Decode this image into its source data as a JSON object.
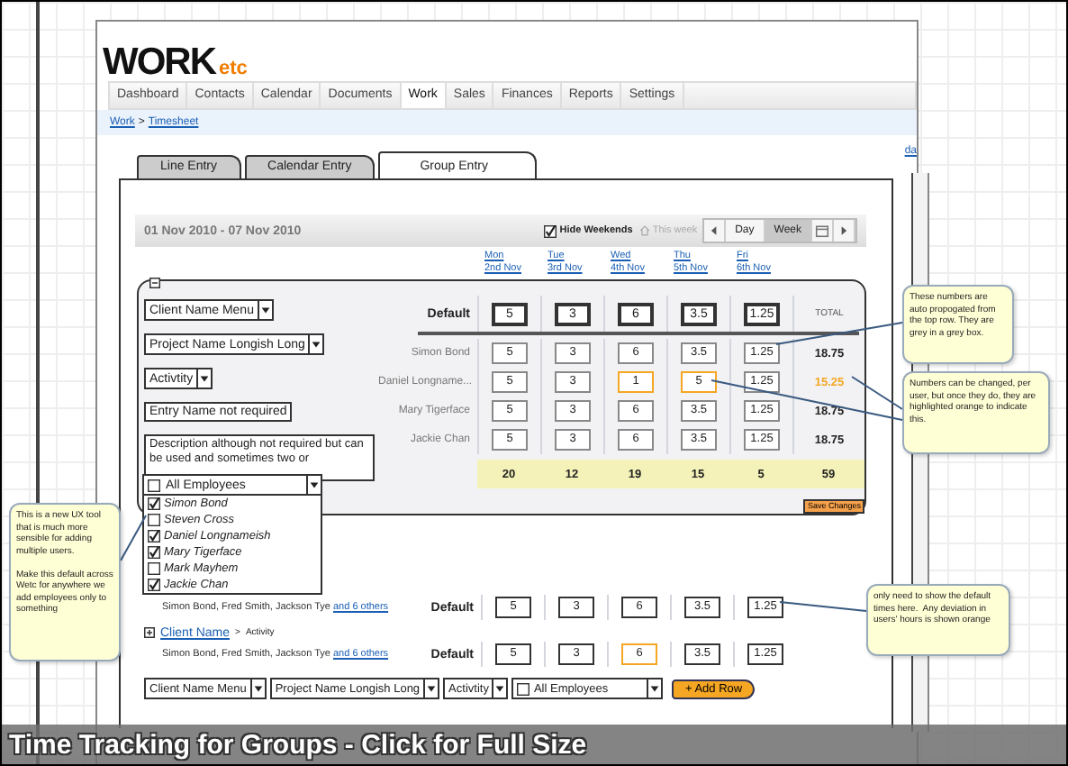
{
  "logo": {
    "text": "WORK",
    "suffix": "etc"
  },
  "nav": [
    {
      "label": "Dashboard",
      "selected": false
    },
    {
      "label": "Contacts",
      "selected": false
    },
    {
      "label": "Calendar",
      "selected": false
    },
    {
      "label": "Documents",
      "selected": false
    },
    {
      "label": "Work",
      "selected": true
    },
    {
      "label": "Sales",
      "selected": false
    },
    {
      "label": "Finances",
      "selected": false
    },
    {
      "label": "Reports",
      "selected": false
    },
    {
      "label": "Settings",
      "selected": false
    }
  ],
  "breadcrumb": {
    "items": [
      "Work",
      "Timesheet"
    ],
    "separator": ">"
  },
  "edge_link": "da",
  "tabs": [
    {
      "label": "Line Entry",
      "selected": false
    },
    {
      "label": "Calendar Entry",
      "selected": false
    },
    {
      "label": "Group Entry",
      "selected": true
    }
  ],
  "date_bar": {
    "range": "01 Nov 2010 - 07 Nov 2010",
    "hide_weekends": {
      "label": "Hide Weekends",
      "checked": true
    },
    "this_week": {
      "label": "This week",
      "disabled": true
    },
    "views": [
      {
        "label": "Day",
        "selected": false
      },
      {
        "label": "Week",
        "selected": true
      }
    ]
  },
  "days": [
    {
      "day": "Mon",
      "date": "2nd Nov"
    },
    {
      "day": "Tue",
      "date": "3rd Nov"
    },
    {
      "day": "Wed",
      "date": "4th Nov"
    },
    {
      "day": "Thu",
      "date": "5th Nov"
    },
    {
      "day": "Fri",
      "date": "6th Nov"
    }
  ],
  "group": {
    "client": "Client Name Menu",
    "project": "Project Name Longish Long",
    "activity": "Activtity",
    "entry_name": "Entry Name not required",
    "description": "Description although not required but can be used and sometimes two or",
    "default_label": "Default",
    "defaults": [
      "5",
      "3",
      "6",
      "3.5",
      "1.25"
    ],
    "total_heading": "TOTAL",
    "members": [
      {
        "name": "Simon Bond",
        "hours": [
          {
            "value": "5",
            "changed": false
          },
          {
            "value": "3",
            "changed": false
          },
          {
            "value": "6",
            "changed": false
          },
          {
            "value": "3.5",
            "changed": false
          },
          {
            "value": "1.25",
            "changed": false
          }
        ],
        "total": "18.75",
        "changed": false
      },
      {
        "name": "Daniel Longname...",
        "hours": [
          {
            "value": "5",
            "changed": false
          },
          {
            "value": "3",
            "changed": false
          },
          {
            "value": "1",
            "changed": true
          },
          {
            "value": "5",
            "changed": true
          },
          {
            "value": "1.25",
            "changed": false
          }
        ],
        "total": "15.25",
        "changed": true
      },
      {
        "name": "Mary Tigerface",
        "hours": [
          {
            "value": "5",
            "changed": false
          },
          {
            "value": "3",
            "changed": false
          },
          {
            "value": "6",
            "changed": false
          },
          {
            "value": "3.5",
            "changed": false
          },
          {
            "value": "1.25",
            "changed": false
          }
        ],
        "total": "18.75",
        "changed": false
      },
      {
        "name": "Jackie Chan",
        "hours": [
          {
            "value": "5",
            "changed": false
          },
          {
            "value": "3",
            "changed": false
          },
          {
            "value": "6",
            "changed": false
          },
          {
            "value": "3.5",
            "changed": false
          },
          {
            "value": "1.25",
            "changed": false
          }
        ],
        "total": "18.75",
        "changed": false
      }
    ],
    "totals": [
      "20",
      "12",
      "19",
      "15",
      "5",
      "59"
    ],
    "save": "Save Changes"
  },
  "employee_picker": {
    "label": "All Employees",
    "checked": false,
    "options": [
      {
        "name": "Simon Bond",
        "checked": true
      },
      {
        "name": "Steven Cross",
        "checked": false
      },
      {
        "name": "Daniel Longnameish",
        "checked": true
      },
      {
        "name": "Mary Tigerface",
        "checked": true
      },
      {
        "name": "Mark Mayhem",
        "checked": false
      },
      {
        "name": "Jackie Chan",
        "checked": true
      }
    ]
  },
  "rows": [
    {
      "kind": "partial",
      "members": "Simon Bond, Fred Smith, Jackson Tye",
      "more": "and 6 others",
      "default_label": "Default",
      "hours": [
        {
          "value": "5",
          "changed": false
        },
        {
          "value": "3",
          "changed": false
        },
        {
          "value": "6",
          "changed": false
        },
        {
          "value": "3.5",
          "changed": false
        },
        {
          "value": "1.25",
          "changed": false
        }
      ]
    },
    {
      "kind": "full",
      "client": "Client Name",
      "separator": ">",
      "activity": "Activity",
      "members": "Simon Bond, Fred Smith, Jackson Tye",
      "more": "and 6 others",
      "default_label": "Default",
      "hours": [
        {
          "value": "5",
          "changed": false
        },
        {
          "value": "3",
          "changed": false
        },
        {
          "value": "6",
          "changed": true
        },
        {
          "value": "3.5",
          "changed": false
        },
        {
          "value": "1.25",
          "changed": false
        }
      ]
    }
  ],
  "new_row": {
    "client": "Client Name Menu",
    "project": "Project Name Longish Long",
    "activity": "Activtity",
    "employees": {
      "label": "All Employees",
      "checked": false
    },
    "add": "+ Add Row"
  },
  "notes": [
    "This is a new UX tool that is much more sensible for adding multiple users.\n\nMake this default across Wetc for anywhere we add employees only to something",
    "These numbers are auto propogated from the top row. They are grey in a grey box.",
    "Numbers can be changed, per user, but once they do, they are highlighted orange to indicate this.",
    "only need to show the default times here.  Any deviation in users' hours is shown orange"
  ],
  "caption": "Time Tracking for Groups - Click for Full Size"
}
